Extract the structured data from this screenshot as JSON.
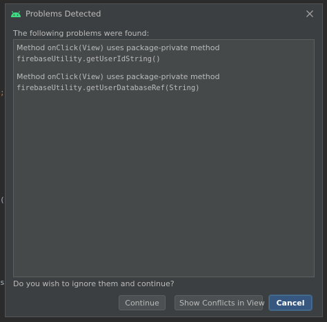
{
  "dialog": {
    "title": "Problems Detected",
    "header": "The following problems were found:",
    "problems": [
      {
        "prefix": "Method ",
        "method": "onClick(View)",
        "suffix": " uses package-private method",
        "target": "firebaseUtility.getUserIdString()"
      },
      {
        "prefix": "Method ",
        "method": "onClick(View)",
        "suffix": " uses package-private method",
        "target": "firebaseUtility.getUserDatabaseRef(String)"
      }
    ],
    "question": "Do you wish to ignore them and continue?",
    "buttons": {
      "continue": "Continue",
      "show_conflicts": "Show Conflicts in View",
      "cancel": "Cancel"
    }
  },
  "background_editor": {
    "gutter_glyphs": [
      ";",
      "(",
      "s"
    ]
  },
  "colors": {
    "dialog_bg": "#3c3f41",
    "panel_bg": "#45494a",
    "text": "#bbbbbb",
    "accent_button": "#365880",
    "android_icon": "#3ddc84"
  },
  "icons": {
    "title": "android-icon",
    "close": "close-icon"
  }
}
